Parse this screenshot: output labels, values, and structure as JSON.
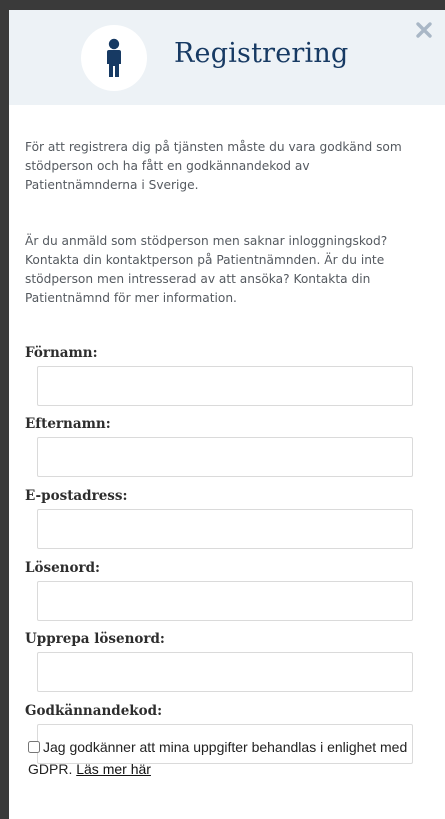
{
  "modal": {
    "title": "Registrering",
    "close_glyph": "×",
    "intro_paragraph_1": "För att registrera dig på tjänsten måste du vara godkänd som stödperson och ha fått en godkännandekod av Patientnämnderna i Sverige.",
    "intro_paragraph_2": "Är du anmäld som stödperson men saknar inloggningskod? Kontakta din kontaktperson på Patientnämnden. Är du inte stödperson men intresserad av att ansöka? Kontakta din Patientnämnd för mer information."
  },
  "form": {
    "fields": [
      {
        "label": "Förnamn:",
        "value": "",
        "type": "text"
      },
      {
        "label": "Efternamn:",
        "value": "",
        "type": "text"
      },
      {
        "label": "E-postadress:",
        "value": "",
        "type": "email"
      },
      {
        "label": "Lösenord:",
        "value": "",
        "type": "password"
      },
      {
        "label": "Upprepa lösenord:",
        "value": "",
        "type": "password"
      },
      {
        "label": "Godkännandekod:",
        "value": "",
        "type": "text"
      }
    ],
    "consent_text": "Jag godkänner att mina uppgifter behandlas i enlighet med GDPR.",
    "consent_link": "Läs mer här",
    "consent_checked": false
  },
  "icons": {
    "avatar": "person-icon",
    "close": "close-icon"
  },
  "colors": {
    "header_background": "#edf2f6",
    "title": "#173a63",
    "close_icon": "#a9b7c6",
    "body_text": "#555a60"
  }
}
